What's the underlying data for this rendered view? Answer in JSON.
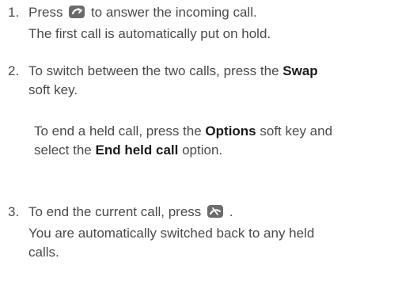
{
  "steps": [
    {
      "number": "1.",
      "line1_before": "Press",
      "line1_icon": "send-call-icon",
      "line1_after": "to answer the incoming call.",
      "line2": "The first call is automatically put on hold."
    },
    {
      "number": "2.",
      "line1_before": "To switch between the two calls, press the",
      "line1_bold": "Swap",
      "line2": "soft key.",
      "note_line1_before": "To end a held call, press the",
      "note_line1_bold": "Options",
      "note_line1_after": "soft key and",
      "note_line2_before": "select the",
      "note_line2_bold": "End held call",
      "note_line2_after": "option."
    },
    {
      "number": "3.",
      "line1_before": "To end the current call, press",
      "line1_icon": "end-call-icon",
      "line1_after": ".",
      "line2": "You are automatically switched back to any held",
      "line3": "calls."
    }
  ]
}
